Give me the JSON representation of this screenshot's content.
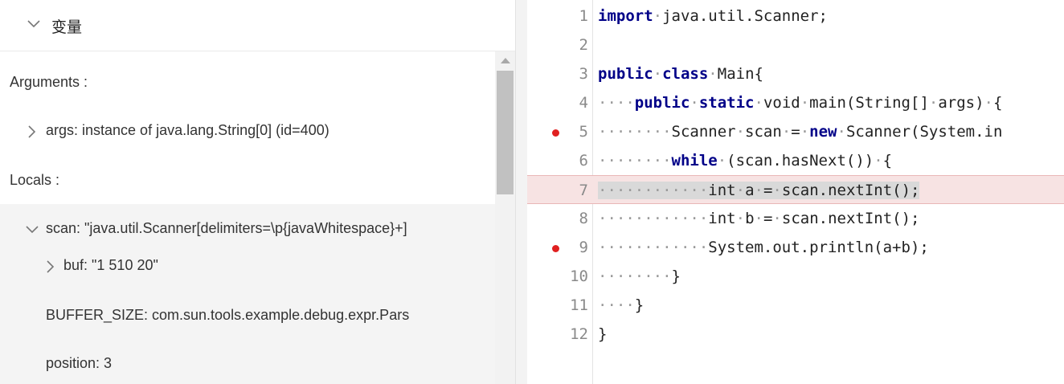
{
  "variables_panel": {
    "title": "变量",
    "arguments_label": "Arguments :",
    "args_entry": "args: instance of java.lang.String[0] (id=400)",
    "locals_label": "Locals :",
    "scan_entry": "scan: \"java.util.Scanner[delimiters=\\p{javaWhitespace}+]",
    "buf_entry": "buf: \"1 510 20\"",
    "buffer_size_entry": "BUFFER_SIZE: com.sun.tools.example.debug.expr.Pars",
    "position_entry": "position: 3"
  },
  "editor": {
    "current_line": 7,
    "breakpoint_lines": [
      5,
      9
    ],
    "lines": [
      {
        "n": "1",
        "tokens": [
          {
            "t": "import",
            "k": "kw"
          },
          {
            "t": "·",
            "k": "ws"
          },
          {
            "t": "java.util.Scanner;",
            "k": ""
          }
        ]
      },
      {
        "n": "2",
        "tokens": []
      },
      {
        "n": "3",
        "tokens": [
          {
            "t": "public",
            "k": "kw"
          },
          {
            "t": "·",
            "k": "ws"
          },
          {
            "t": "class",
            "k": "kw"
          },
          {
            "t": "·",
            "k": "ws"
          },
          {
            "t": "Main{",
            "k": ""
          }
        ]
      },
      {
        "n": "4",
        "tokens": [
          {
            "t": "····",
            "k": "ws"
          },
          {
            "t": "public",
            "k": "kw"
          },
          {
            "t": "·",
            "k": "ws"
          },
          {
            "t": "static",
            "k": "kw"
          },
          {
            "t": "·",
            "k": "ws"
          },
          {
            "t": "void",
            "k": ""
          },
          {
            "t": "·",
            "k": "ws"
          },
          {
            "t": "main(String[]",
            "k": ""
          },
          {
            "t": "·",
            "k": "ws"
          },
          {
            "t": "args)",
            "k": ""
          },
          {
            "t": "·",
            "k": "ws"
          },
          {
            "t": "{",
            "k": ""
          }
        ]
      },
      {
        "n": "5",
        "tokens": [
          {
            "t": "········",
            "k": "ws"
          },
          {
            "t": "Scanner",
            "k": ""
          },
          {
            "t": "·",
            "k": "ws"
          },
          {
            "t": "scan",
            "k": ""
          },
          {
            "t": "·",
            "k": "ws"
          },
          {
            "t": "=",
            "k": ""
          },
          {
            "t": "·",
            "k": "ws"
          },
          {
            "t": "new",
            "k": "kw"
          },
          {
            "t": "·",
            "k": "ws"
          },
          {
            "t": "Scanner(System.in",
            "k": ""
          }
        ]
      },
      {
        "n": "6",
        "tokens": [
          {
            "t": "········",
            "k": "ws"
          },
          {
            "t": "while",
            "k": "kw"
          },
          {
            "t": "·",
            "k": "ws"
          },
          {
            "t": "(scan.hasNext())",
            "k": ""
          },
          {
            "t": "·",
            "k": "ws"
          },
          {
            "t": "{",
            "k": ""
          }
        ]
      },
      {
        "n": "7",
        "tokens": [
          {
            "t": "············",
            "k": "ws hl"
          },
          {
            "t": "int",
            "k": "hl"
          },
          {
            "t": "·",
            "k": "ws hl"
          },
          {
            "t": "a",
            "k": "hl"
          },
          {
            "t": "·",
            "k": "ws hl"
          },
          {
            "t": "=",
            "k": "hl"
          },
          {
            "t": "·",
            "k": "ws hl"
          },
          {
            "t": "scan.nextInt();",
            "k": "hl"
          }
        ]
      },
      {
        "n": "8",
        "tokens": [
          {
            "t": "············",
            "k": "ws"
          },
          {
            "t": "int",
            "k": ""
          },
          {
            "t": "·",
            "k": "ws"
          },
          {
            "t": "b",
            "k": ""
          },
          {
            "t": "·",
            "k": "ws"
          },
          {
            "t": "=",
            "k": ""
          },
          {
            "t": "·",
            "k": "ws"
          },
          {
            "t": "scan.nextInt();",
            "k": ""
          }
        ]
      },
      {
        "n": "9",
        "tokens": [
          {
            "t": "············",
            "k": "ws"
          },
          {
            "t": "System.out.println(a+b);",
            "k": ""
          }
        ]
      },
      {
        "n": "10",
        "tokens": [
          {
            "t": "········",
            "k": "ws"
          },
          {
            "t": "}",
            "k": ""
          }
        ]
      },
      {
        "n": "11",
        "tokens": [
          {
            "t": "····",
            "k": "ws"
          },
          {
            "t": "}",
            "k": ""
          }
        ]
      },
      {
        "n": "12",
        "tokens": [
          {
            "t": "}",
            "k": ""
          }
        ]
      }
    ]
  },
  "colors": {
    "keyword": "#000088",
    "breakpoint": "#e02020",
    "current_line_bg": "#f7e3e3"
  }
}
